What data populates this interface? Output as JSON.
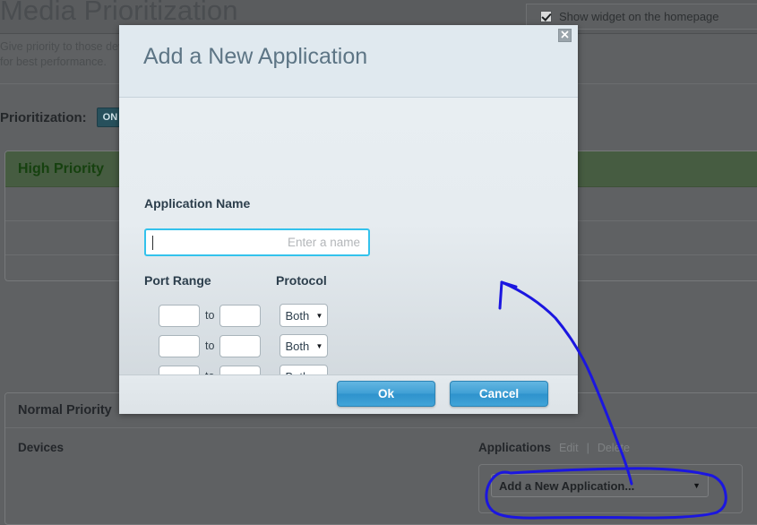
{
  "page": {
    "title": "Media Prioritization",
    "description": "Give priority to those devices and services for best performance.",
    "show_widget_label": "Show widget on the homepage",
    "show_widget_checked": true,
    "prioritization_label": "Prioritization:",
    "prioritization_state": "ON"
  },
  "panels": {
    "high": {
      "header": "High Priority"
    },
    "normal": {
      "header": "Normal Priority",
      "devices_label": "Devices",
      "applications_label": "Applications",
      "edit_link": "Edit",
      "separator": "|",
      "delete_link": "Delete",
      "app_select_value": "Add a New Application...",
      "app_select_caret": "▼"
    }
  },
  "modal": {
    "title": "Add a New Application",
    "close_icon": "☒",
    "app_name_label": "Application Name",
    "app_name_value": "",
    "app_name_placeholder": "Enter a name",
    "port_range_label": "Port Range",
    "protocol_label": "Protocol",
    "to_label": "to",
    "caret": "▼",
    "rows": [
      {
        "from": "",
        "to": "",
        "protocol": "Both"
      },
      {
        "from": "",
        "to": "",
        "protocol": "Both"
      },
      {
        "from": "",
        "to": "",
        "protocol": "Both"
      }
    ],
    "ok_label": "Ok",
    "cancel_label": "Cancel"
  },
  "colors": {
    "page_bg": "#5f6163",
    "high_priority_header": "#465c41",
    "high_priority_text": "#16410f",
    "modal_header_bg": "#e0e9ef",
    "modal_title_text": "#5d7585",
    "focus_border": "#33c2ec",
    "button_blue": "#3f9fd4",
    "toggle_on": "#27505c",
    "annotation": "#1b16e0"
  }
}
